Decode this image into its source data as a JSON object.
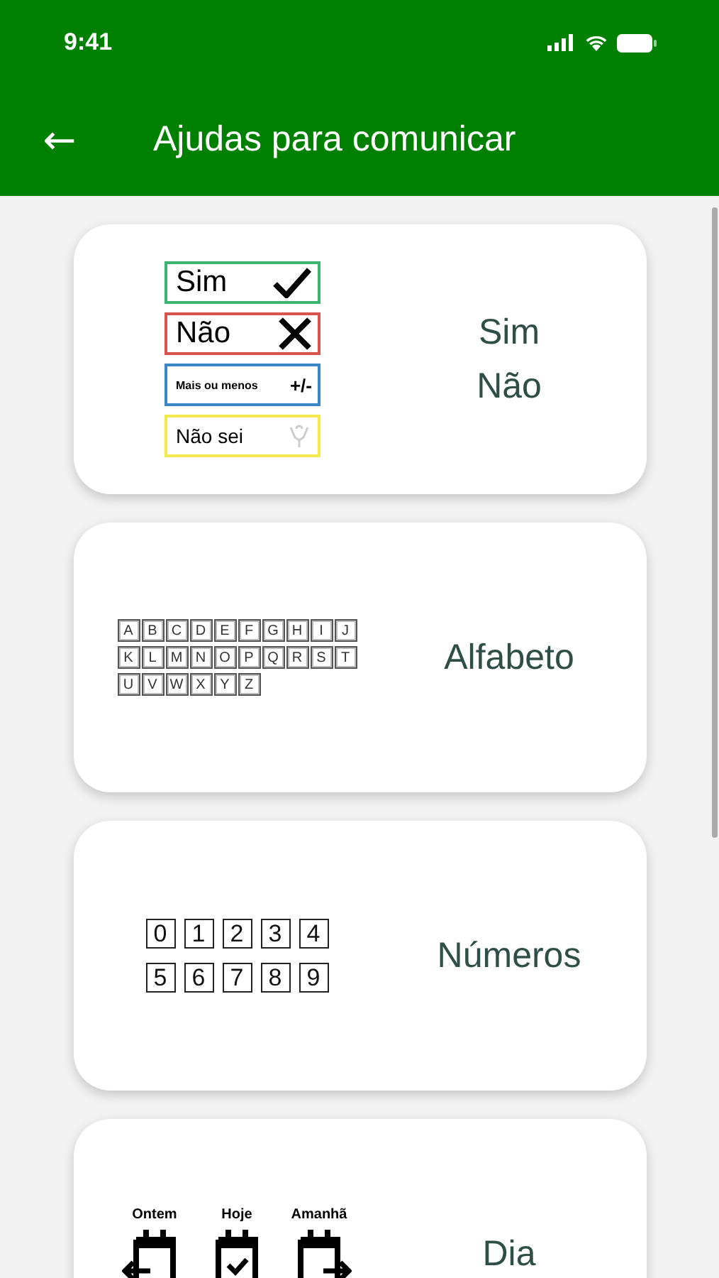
{
  "status_bar": {
    "time": "9:41"
  },
  "header": {
    "back": "←",
    "title": "Ajudas para comunicar"
  },
  "cards": [
    {
      "kind": "yes_no",
      "title_lines": [
        "Sim\nNão"
      ],
      "options": [
        {
          "label": "Sim",
          "kind": "check",
          "color": "#3cb371"
        },
        {
          "label": "Não",
          "kind": "cross",
          "color": "#d9534f"
        },
        {
          "label": "Mais ou menos",
          "kind": "text",
          "symbol": "+/-",
          "color": "#3a87c8"
        },
        {
          "label": "Não sei",
          "kind": "hands",
          "color": "#f2e94e"
        }
      ]
    },
    {
      "kind": "letters",
      "title_lines": [
        "Alfabeto"
      ],
      "rows": [
        [
          "A",
          "B",
          "C",
          "D",
          "E",
          "F",
          "G",
          "H",
          "I",
          "J"
        ],
        [
          "K",
          "L",
          "M",
          "N",
          "O",
          "P",
          "Q",
          "R",
          "S",
          "T"
        ],
        [
          "U",
          "V",
          "W",
          "X",
          "Y",
          "Z"
        ]
      ]
    },
    {
      "kind": "numbers",
      "title_lines": [
        "Números"
      ],
      "rows": [
        [
          "0",
          "1",
          "2",
          "3",
          "4"
        ],
        [
          "5",
          "6",
          "7",
          "8",
          "9"
        ]
      ]
    },
    {
      "kind": "days",
      "title_lines": [
        "Dia"
      ],
      "days": [
        {
          "label": "Ontem",
          "kind": "left"
        },
        {
          "label": "Hoje",
          "kind": "check"
        },
        {
          "label": "Amanhã",
          "kind": "right"
        }
      ]
    }
  ]
}
